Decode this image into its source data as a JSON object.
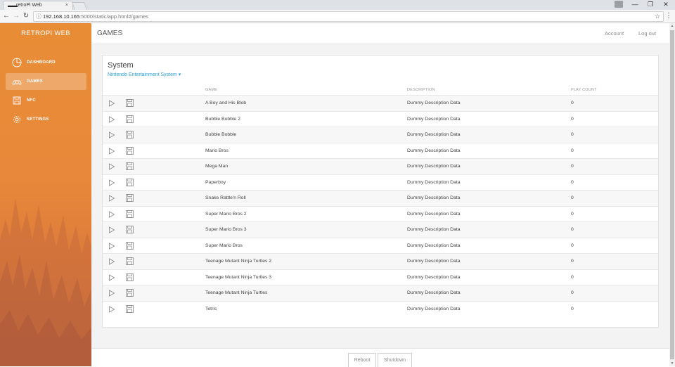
{
  "browser": {
    "tab_title": "retroPi Web",
    "tab_close": "×",
    "url_host": "192.168.10.165",
    "url_path": ":5000/static/app.html#/games",
    "minimize": "—",
    "maximize": "❐",
    "close": "✕",
    "back": "←",
    "forward": "→",
    "reload": "↻",
    "star": "☆",
    "menu": "⋮",
    "info": "ⓘ"
  },
  "sidebar": {
    "brand": "RETROPI WEB",
    "items": [
      {
        "label": "DASHBOARD",
        "icon": "dashboard-icon",
        "active": false
      },
      {
        "label": "GAMES",
        "icon": "gamepad-icon",
        "active": true
      },
      {
        "label": "NFC",
        "icon": "floppy-icon",
        "active": false
      },
      {
        "label": "SETTINGS",
        "icon": "gear-icon",
        "active": false
      }
    ]
  },
  "header": {
    "title": "GAMES",
    "account": "Account",
    "logout": "Log out"
  },
  "system": {
    "title": "System",
    "selected": "Nintendo Entertainment System ▾"
  },
  "table": {
    "columns": {
      "game": "GAME",
      "description": "DESCRIPTION",
      "play_count": "PLAY COUNT"
    },
    "rows": [
      {
        "game": "A Boy and His Blob",
        "description": "Dummy Description Data",
        "play_count": "0"
      },
      {
        "game": "Bubble Bobble 2",
        "description": "Dummy Description Data",
        "play_count": "0"
      },
      {
        "game": "Bubble Bobble",
        "description": "Dummy Description Data",
        "play_count": "0"
      },
      {
        "game": "Mario Bros",
        "description": "Dummy Description Data",
        "play_count": "0"
      },
      {
        "game": "Mega Man",
        "description": "Dummy Description Data",
        "play_count": "0"
      },
      {
        "game": "Paperboy",
        "description": "Dummy Description Data",
        "play_count": "0"
      },
      {
        "game": "Snake Rattle'n Roll",
        "description": "Dummy Description Data",
        "play_count": "0"
      },
      {
        "game": "Super Mario Bros 2",
        "description": "Dummy Description Data",
        "play_count": "0"
      },
      {
        "game": "Super Mario Bros 3",
        "description": "Dummy Description Data",
        "play_count": "0"
      },
      {
        "game": "Super Mario Bros",
        "description": "Dummy Description Data",
        "play_count": "0"
      },
      {
        "game": "Teenage Mutant Ninja Turtles 2",
        "description": "Dummy Description Data",
        "play_count": "0"
      },
      {
        "game": "Teenage Mutant Ninja Turtles 3",
        "description": "Dummy Description Data",
        "play_count": "0"
      },
      {
        "game": "Teenage Mutant Ninja Turtles",
        "description": "Dummy Description Data",
        "play_count": "0"
      },
      {
        "game": "Tetris",
        "description": "Dummy Description Data",
        "play_count": "0"
      }
    ]
  },
  "footer": {
    "reboot": "Reboot",
    "shutdown": "Shutdown"
  },
  "colors": {
    "sidebar_orange": "#e88d36",
    "link_blue": "#2d9cdb"
  }
}
